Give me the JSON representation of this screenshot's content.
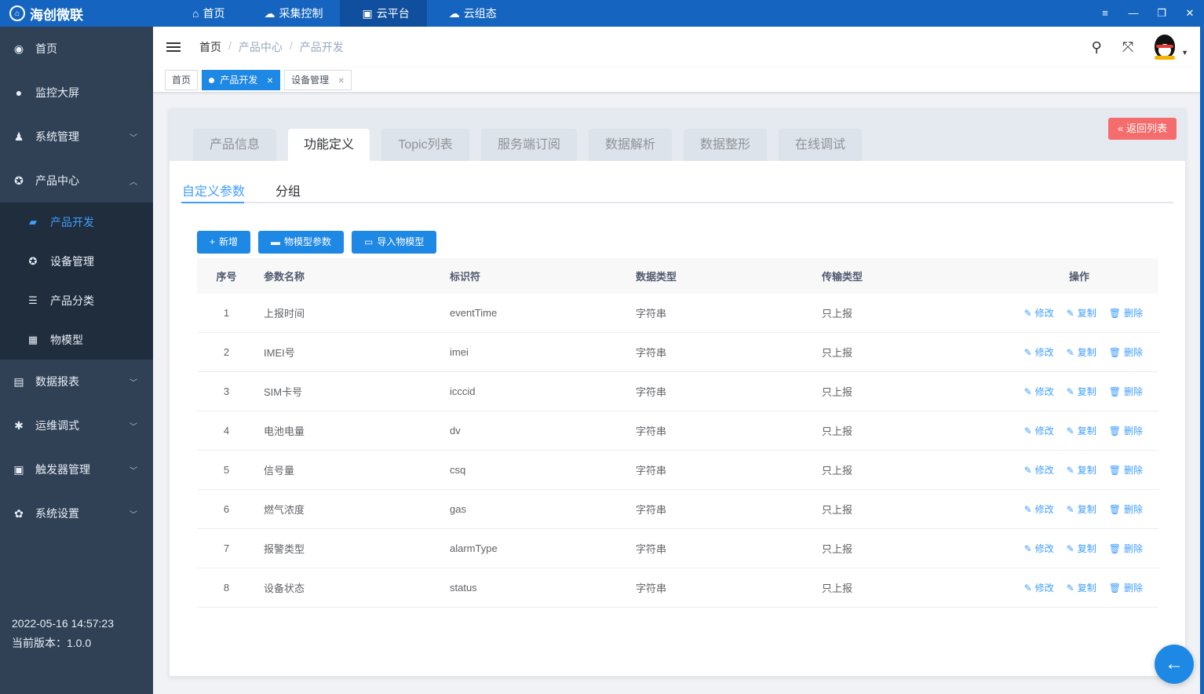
{
  "brand": {
    "name": "海创微联",
    "icon": "app-logo-icon"
  },
  "topnav": [
    {
      "label": "首页",
      "icon": "home-icon",
      "active": false
    },
    {
      "label": "采集控制",
      "icon": "cloud-control-icon",
      "active": false
    },
    {
      "label": "云平台",
      "icon": "cloud-platform-icon",
      "active": true
    },
    {
      "label": "云组态",
      "icon": "cloud-config-icon",
      "active": false
    }
  ],
  "sidebar": {
    "items": [
      {
        "label": "首页",
        "icon": "dashboard-icon"
      },
      {
        "label": "监控大屏",
        "icon": "globe-icon"
      },
      {
        "label": "系统管理",
        "icon": "user-icon"
      },
      {
        "label": "产品中心",
        "icon": "product-icon"
      }
    ],
    "sub_items": [
      {
        "label": "产品开发",
        "icon": "book-icon",
        "active": true
      },
      {
        "label": "设备管理",
        "icon": "device-icon",
        "active": false
      },
      {
        "label": "产品分类",
        "icon": "list-icon",
        "active": false
      },
      {
        "label": "物模型",
        "icon": "grid-icon",
        "active": false
      }
    ],
    "bottom_items": [
      {
        "label": "数据报表",
        "icon": "report-icon"
      },
      {
        "label": "运维调式",
        "icon": "bug-icon"
      },
      {
        "label": "触发器管理",
        "icon": "trigger-icon"
      },
      {
        "label": "系统设置",
        "icon": "gear-icon"
      }
    ],
    "datetime": "2022-05-16 14:57:23",
    "version": "当前版本：1.0.0"
  },
  "breadcrumb": [
    "首页",
    "产品中心",
    "产品开发"
  ],
  "tags": [
    {
      "label": "首页"
    },
    {
      "label": "产品开发"
    },
    {
      "label": "设备管理"
    }
  ],
  "card_tabs": [
    "产品信息",
    "功能定义",
    "Topic列表",
    "服务端订阅",
    "数据解析",
    "数据整形",
    "在线调试"
  ],
  "back_button": "返回列表",
  "subtabs": [
    "自定义参数",
    "分组"
  ],
  "toolbar": {
    "add": "新增",
    "model_params": "物模型参数",
    "import_model": "导入物模型"
  },
  "table": {
    "headers": [
      "序号",
      "参数名称",
      "标识符",
      "数据类型",
      "传输类型",
      "操作"
    ],
    "ops": [
      "修改",
      "复制",
      "删除"
    ],
    "rows": [
      {
        "idx": "1",
        "name": "上报时间",
        "ident": "eventTime",
        "dtype": "字符串",
        "ttype": "只上报"
      },
      {
        "idx": "2",
        "name": "IMEI号",
        "ident": "imei",
        "dtype": "字符串",
        "ttype": "只上报"
      },
      {
        "idx": "3",
        "name": "SIM卡号",
        "ident": "icccid",
        "dtype": "字符串",
        "ttype": "只上报"
      },
      {
        "idx": "4",
        "name": "电池电量",
        "ident": "dv",
        "dtype": "字符串",
        "ttype": "只上报"
      },
      {
        "idx": "5",
        "name": "信号量",
        "ident": "csq",
        "dtype": "字符串",
        "ttype": "只上报"
      },
      {
        "idx": "6",
        "name": "燃气浓度",
        "ident": "gas",
        "dtype": "字符串",
        "ttype": "只上报"
      },
      {
        "idx": "7",
        "name": "报警类型",
        "ident": "alarmType",
        "dtype": "字符串",
        "ttype": "只上报"
      },
      {
        "idx": "8",
        "name": "设备状态",
        "ident": "status",
        "dtype": "字符串",
        "ttype": "只上报"
      }
    ]
  },
  "colors": {
    "primary": "#1e88e5",
    "topbar": "#1565c0",
    "sidebar": "#304156",
    "danger": "#f56c6c",
    "link": "#409eff"
  }
}
